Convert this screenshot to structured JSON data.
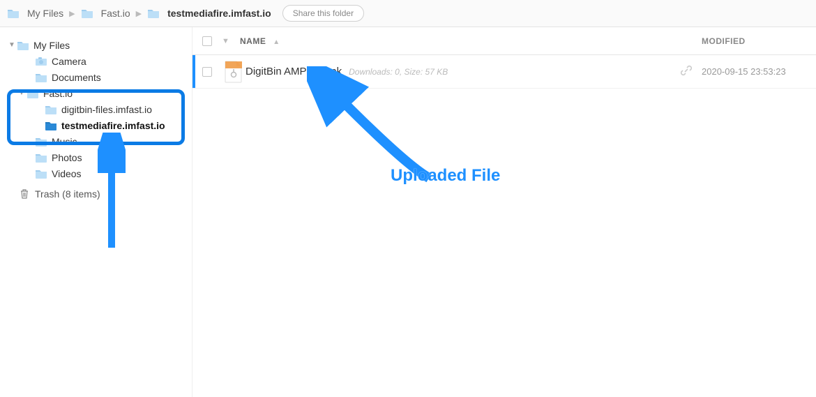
{
  "breadcrumb": {
    "items": [
      {
        "label": "My Files",
        "active": false
      },
      {
        "label": "Fast.io",
        "active": false
      },
      {
        "label": "testmediafire.imfast.io",
        "active": true
      }
    ],
    "share_label": "Share this folder"
  },
  "sidebar": {
    "root": {
      "label": "My Files"
    },
    "camera": "Camera",
    "documents": "Documents",
    "fastio": "Fast.io",
    "digitbin": "digitbin-files.imfast.io",
    "testmedia": "testmediafire.imfast.io",
    "music": "Music",
    "photos": "Photos",
    "videos": "Videos",
    "trash": "Trash (8 items)"
  },
  "columns": {
    "name": "NAME",
    "modified": "MODIFIED"
  },
  "file": {
    "name": "DigitBin AMP (1).apk",
    "meta": "Downloads: 0, Size: 57 KB",
    "date": "2020-09-15 23:53:23"
  },
  "annotation": {
    "label": "Uploaded File"
  }
}
